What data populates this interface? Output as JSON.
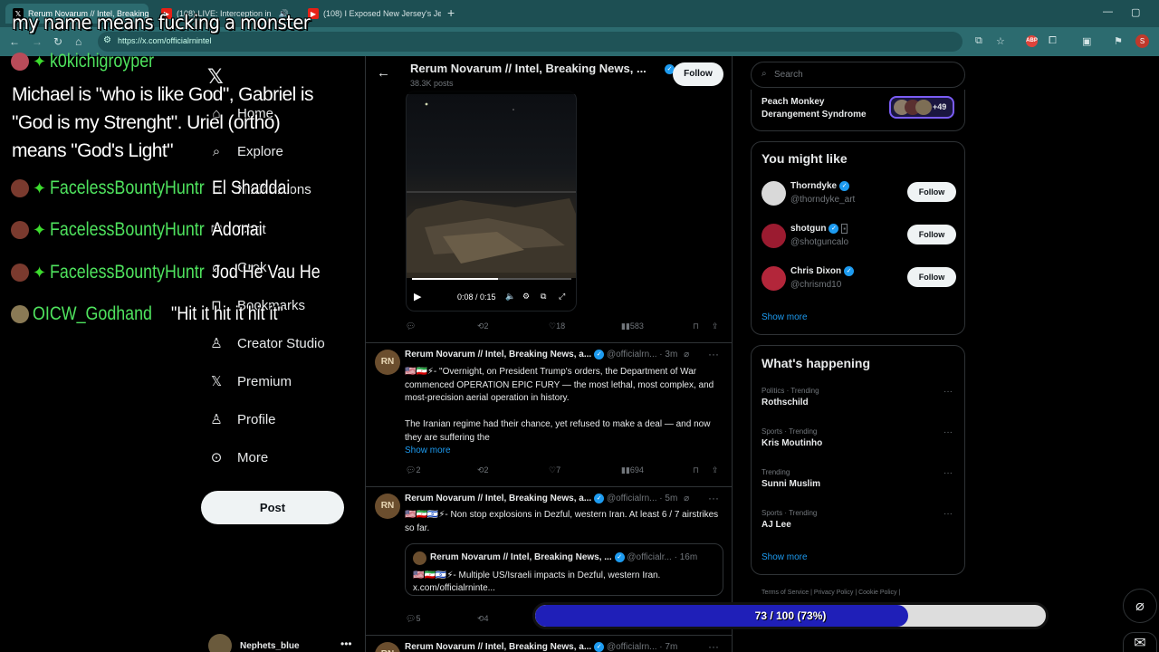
{
  "browser": {
    "tabs": [
      {
        "title": "Rerum Novarum // Intel, Breaking"
      },
      {
        "title": "(108) LIVE: Interception in"
      },
      {
        "title": "(108) I Exposed New Jersey's Je"
      }
    ],
    "url": "https://x.com/officialrnintel"
  },
  "sidebar": {
    "items": [
      {
        "label": "Home",
        "icon": "home-icon"
      },
      {
        "label": "Explore",
        "icon": "search-icon"
      },
      {
        "label": "Notifications",
        "icon": "bell-icon"
      },
      {
        "label": "Chat",
        "icon": "mail-icon"
      },
      {
        "label": "Grok",
        "icon": "grok-icon"
      },
      {
        "label": "Bookmarks",
        "icon": "bookmark-icon"
      },
      {
        "label": "Creator Studio",
        "icon": "creator-icon"
      },
      {
        "label": "Premium",
        "icon": "x-icon"
      },
      {
        "label": "Profile",
        "icon": "person-icon"
      },
      {
        "label": "More",
        "icon": "more-icon"
      }
    ],
    "post_label": "Post",
    "account_name": "Nephets_blue"
  },
  "header": {
    "title": "Rerum Novarum // Intel, Breaking News, ...",
    "posts": "38.3K posts",
    "follow_label": "Follow"
  },
  "video": {
    "time": "0:08 / 0:15",
    "progress": 0.54
  },
  "tweet0_actions": {
    "replies": "",
    "reposts": "2",
    "likes": "18",
    "views": "583"
  },
  "tweets": [
    {
      "name": "Rerum Novarum // Intel, Breaking News, a...",
      "handle": "@officialrn...",
      "time": "· 3m",
      "body1": "🇺🇸🇮🇷⚡- \"Overnight, on President Trump's orders, the Department of War commenced OPERATION EPIC FURY — the most lethal, most complex, and most-precision aerial operation in history.",
      "body2": "The Iranian regime had their chance, yet refused to make a deal — and now they are suffering the",
      "show_more": "Show more",
      "replies": "2",
      "reposts": "2",
      "likes": "7",
      "views": "694"
    },
    {
      "name": "Rerum Novarum // Intel, Breaking News, a...",
      "handle": "@officialrn...",
      "time": "· 5m",
      "body1": "🇺🇸🇮🇷🇮🇱⚡- Non stop explosions in Dezful, western Iran. At least 6 / 7 airstrikes so far.",
      "quote_name": "Rerum Novarum // Intel, Breaking News, ...",
      "quote_handle": "@officialr...",
      "quote_time": "· 16m",
      "quote_body": "🇺🇸🇮🇷🇮🇱⚡- Multiple US/Israeli impacts in Dezful, western Iran. x.com/officialrninte...",
      "replies": "5",
      "reposts": "4"
    },
    {
      "name": "Rerum Novarum // Intel, Breaking News, a...",
      "handle": "@officialrn...",
      "time": "· 7m"
    }
  ],
  "right": {
    "search_placeholder": "Search",
    "peach_text": "Peach Monkey Derangement Syndrome",
    "peach_count": "+49",
    "you_might_like": "You might like",
    "who": [
      {
        "name": "Thorndyke",
        "handle": "@thorndyke_art",
        "follow": "Follow",
        "color": "#d9d9d9"
      },
      {
        "name": "shotgun",
        "handle": "@shotguncalo",
        "follow": "Follow",
        "color": "#9b1b30"
      },
      {
        "name": "Chris Dixon",
        "handle": "@chrismd10",
        "follow": "Follow",
        "color": "#b3263a"
      }
    ],
    "show_more": "Show more",
    "whats_happening": "What's happening",
    "trends": [
      {
        "cat": "Politics · Trending",
        "title": "Rothschild"
      },
      {
        "cat": "Sports · Trending",
        "title": "Kris Moutinho"
      },
      {
        "cat": "Trending",
        "title": "Sunni Muslim"
      },
      {
        "cat": "Sports · Trending",
        "title": "AJ Lee"
      }
    ],
    "show_more2": "Show more",
    "footer": "Terms of Service  |  Privacy Policy  |  Cookie Policy  |"
  },
  "overlay": {
    "title": "my name means fucking a monster",
    "chat": [
      {
        "user": "k0kichigroyper",
        "msg": ""
      },
      {
        "user": "FacelessBountyHuntr",
        "msg": "El Shaddai"
      },
      {
        "user": "FacelessBountyHuntr",
        "msg": "Adonai"
      },
      {
        "user": "FacelessBountyHuntr",
        "msg": "Jod He Vau He"
      },
      {
        "user": "OICW_Godhand",
        "msg": "\"Hit it hit it hit it\""
      }
    ],
    "long_msg": "Michael is \"who is like God\", Gabriel is \"God is my Strenght\". Uriel (ortho) means \"God's Light\"",
    "goal_label": "73 / 100 (73%)",
    "goal_fraction": 0.73
  }
}
